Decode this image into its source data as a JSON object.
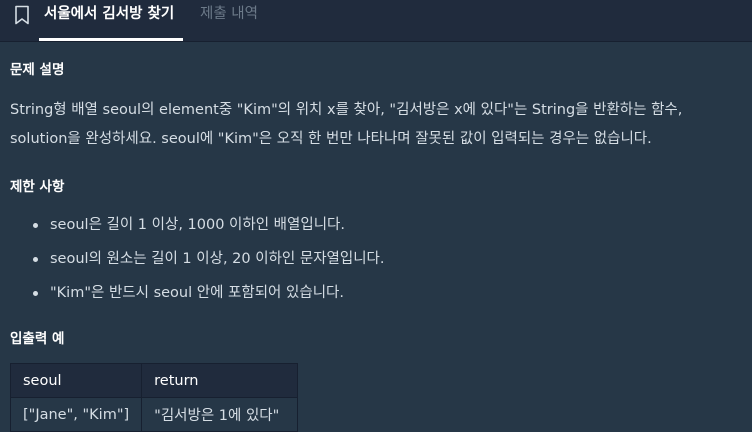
{
  "tabs": {
    "active_label": "서울에서 김서방 찾기",
    "inactive_label": "제출 내역"
  },
  "problem": {
    "heading": "문제 설명",
    "line1": "String형 배열 seoul의 element중 \"Kim\"의 위치 x를 찾아, \"김서방은 x에 있다\"는 String을 반환하는 함수,",
    "line2": "solution을 완성하세요. seoul에 \"Kim\"은 오직 한 번만 나타나며 잘못된 값이 입력되는 경우는 없습니다."
  },
  "constraints": {
    "heading": "제한 사항",
    "items": [
      "seoul은 길이 1 이상, 1000 이하인 배열입니다.",
      "seoul의 원소는 길이 1 이상, 20 이하인 문자열입니다.",
      "\"Kim\"은 반드시 seoul 안에 포함되어 있습니다."
    ]
  },
  "examples": {
    "heading": "입출력 예",
    "columns": [
      "seoul",
      "return"
    ],
    "rows": [
      [
        "[\"Jane\", \"Kim\"]",
        "\"김서방은 1에 있다\""
      ]
    ]
  },
  "icons": {
    "bookmark": "bookmark-icon"
  },
  "colors": {
    "background": "#263747",
    "tabbar": "#202b3d",
    "text": "#d5dde4",
    "inactive_tab": "#6c7a89"
  }
}
